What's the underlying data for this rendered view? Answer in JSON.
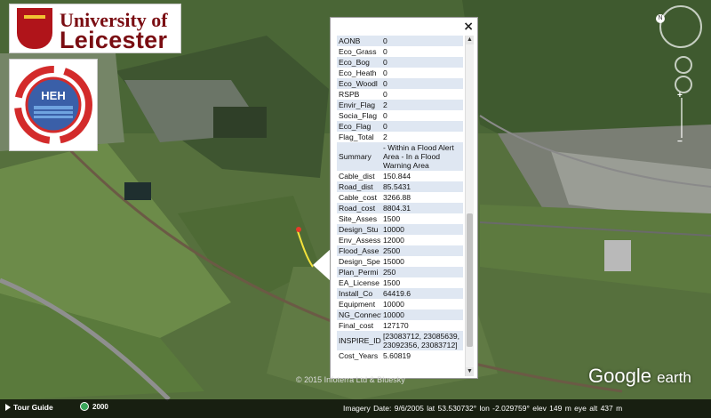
{
  "logos": {
    "university_line1": "University of",
    "university_line2": "Leicester",
    "heh_text": "HEH"
  },
  "balloon": {
    "close_label": "×",
    "rows": [
      {
        "k": "AONB",
        "v": "0"
      },
      {
        "k": "Eco_Grass",
        "v": "0"
      },
      {
        "k": "Eco_Bog",
        "v": "0"
      },
      {
        "k": "Eco_Heath",
        "v": "0"
      },
      {
        "k": "Eco_Woodl",
        "v": "0"
      },
      {
        "k": "RSPB",
        "v": "0"
      },
      {
        "k": "Envir_Flag",
        "v": "2"
      },
      {
        "k": "Socia_Flag",
        "v": "0"
      },
      {
        "k": "Eco_Flag",
        "v": "0"
      },
      {
        "k": "Flag_Total",
        "v": "2"
      },
      {
        "k": "Summary",
        "v": " - Within a Flood Alert Area - In a Flood Warning Area"
      },
      {
        "k": "Cable_dist",
        "v": "150.844"
      },
      {
        "k": "Road_dist",
        "v": "85.5431"
      },
      {
        "k": "Cable_cost",
        "v": "3266.88"
      },
      {
        "k": "Road_cost",
        "v": "8804.31"
      },
      {
        "k": "Site_Asses",
        "v": "1500"
      },
      {
        "k": "Design_Stu",
        "v": "10000"
      },
      {
        "k": "Env_Assess",
        "v": "12000"
      },
      {
        "k": "Flood_Asse",
        "v": "2500"
      },
      {
        "k": "Design_Spe",
        "v": "15000"
      },
      {
        "k": "Plan_Permi",
        "v": "250"
      },
      {
        "k": "EA_License",
        "v": "1500"
      },
      {
        "k": "Install_Co",
        "v": "64419.6"
      },
      {
        "k": "Equipment",
        "v": "10000"
      },
      {
        "k": "NG_Connect",
        "v": "10000"
      },
      {
        "k": "Final_cost",
        "v": "127170"
      },
      {
        "k": "INSPIRE_ID",
        "v": "[23083712, 23085639, 23092356, 23083712]"
      },
      {
        "k": "Cost_Years",
        "v": "5.60819"
      }
    ]
  },
  "statusbar": {
    "tour_label": "Tour Guide",
    "year_label": "2000",
    "status_text": "Imagery Date: 9/6/2005    lat   53.530732°  lon  -2.029759°  elev   149 m    eye alt   437 m"
  },
  "copyright": "© 2015 Infoterra Ltd & Bluesky",
  "google_earth": {
    "google": "Google",
    "earth": "earth"
  },
  "colors": {
    "accent": "#7a0d12",
    "row_alt": "#dfe7f2"
  }
}
